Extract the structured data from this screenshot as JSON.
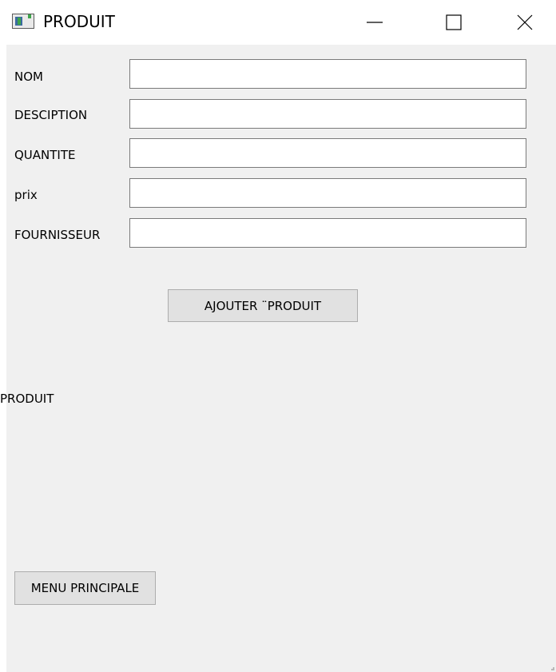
{
  "window": {
    "title": "PRODUIT",
    "icon": "app-window-icon",
    "controls": [
      "minimize-icon",
      "maximize-icon",
      "close-icon"
    ]
  },
  "form": {
    "fields": [
      {
        "label": "NOM",
        "value": "",
        "placeholder": ""
      },
      {
        "label": "DESCIPTION",
        "value": "",
        "placeholder": ""
      },
      {
        "label": "QUANTITE",
        "value": "",
        "placeholder": ""
      },
      {
        "label": "prix",
        "value": "",
        "placeholder": ""
      },
      {
        "label": "FOURNISSEUR",
        "value": "",
        "placeholder": ""
      }
    ],
    "add_button_label": "AJOUTER ¨PRODUIT"
  },
  "section_label": "PRODUIT",
  "menu_button_label": "MENU PRINCIPALE",
  "colors": {
    "client_background": "#f0f0f0",
    "button_background": "#e1e1e1",
    "input_border": "#7a7a7a"
  }
}
